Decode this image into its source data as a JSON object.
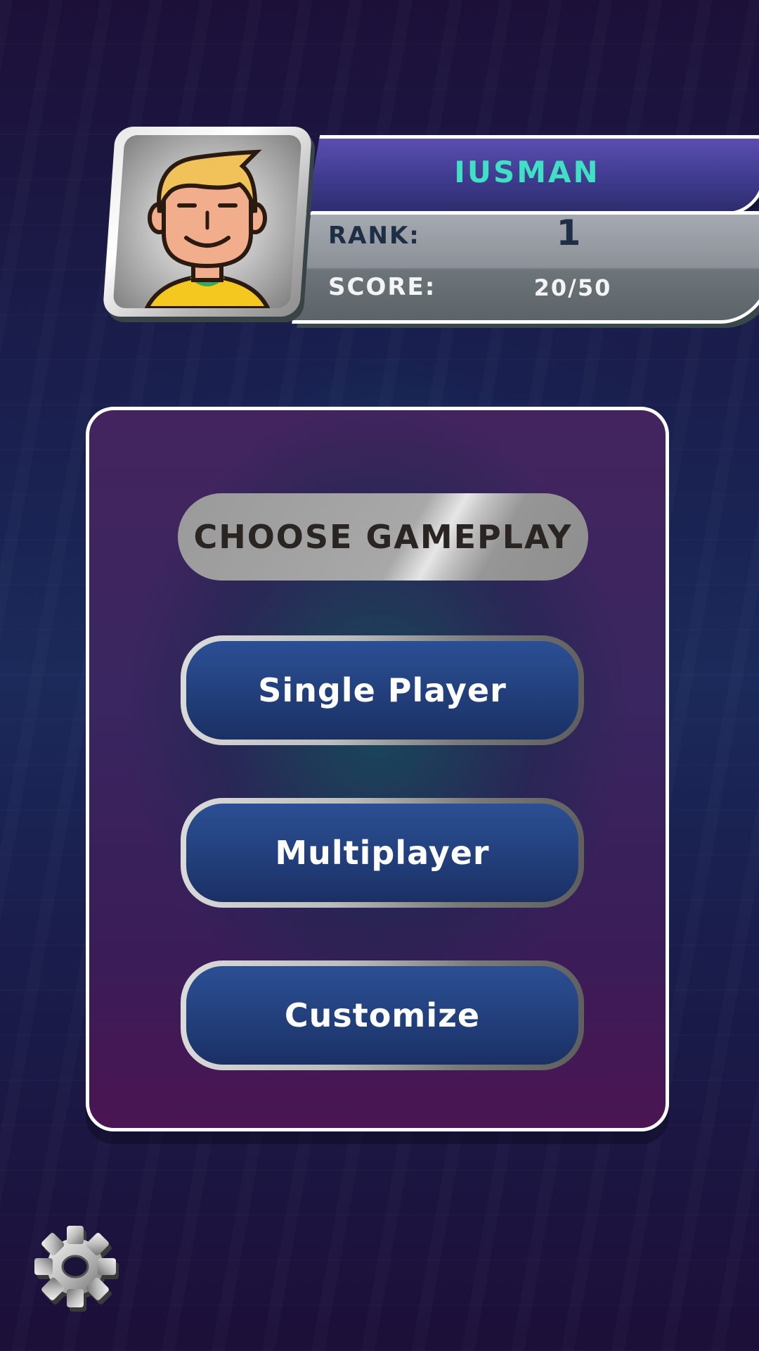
{
  "player": {
    "name": "IUSMAN",
    "rank_label": "RANK:",
    "rank_value": "1",
    "score_label": "SCORE:",
    "score_value": "20/50"
  },
  "menu": {
    "title": "CHOOSE GAMEPLAY",
    "single_player_label": "Single Player",
    "multiplayer_label": "Multiplayer",
    "customize_label": "Customize"
  },
  "icons": {
    "avatar": "avatar-icon",
    "settings": "gear-icon"
  },
  "colors": {
    "name_text": "#3fe0c3",
    "button_fill": "#223f7b",
    "panel_border": "#ffffff"
  }
}
